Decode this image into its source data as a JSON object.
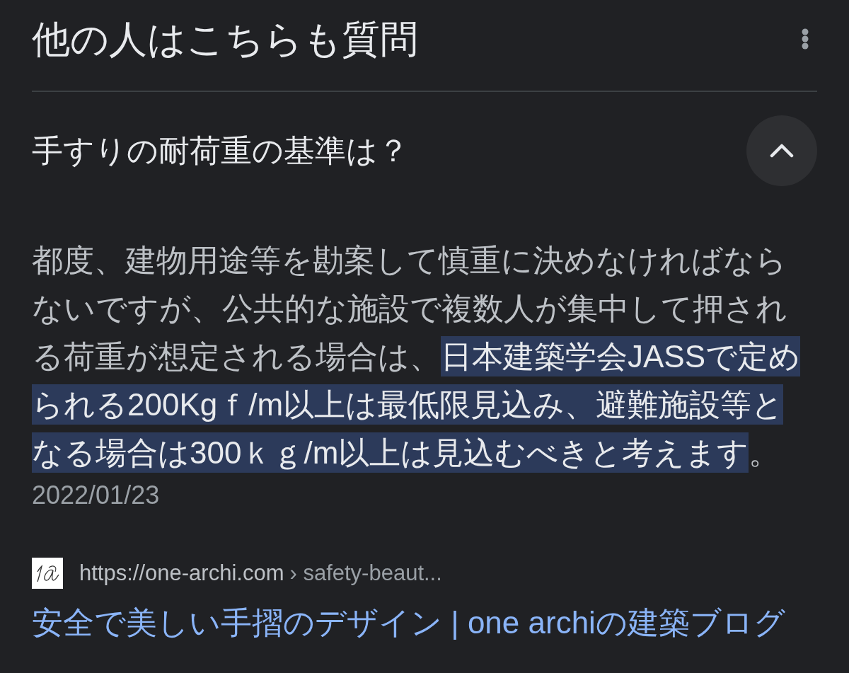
{
  "header": {
    "title": "他の人はこちらも質問"
  },
  "questions": [
    {
      "question": "手すりの耐荷重の基準は？",
      "expanded": true,
      "answer": {
        "segments": [
          {
            "text": "都度、建物用途等を勘案して慎重に決めなければならないですが、公共的な施設で複数人が集中して押される荷重が想定される場合は、",
            "highlighted": false
          },
          {
            "text": "日本建築学会JASSで定められる200Kgｆ/m以上は最低限見込み、避難施設等となる場合は300ｋｇ/m以上は見込むべきと考えます",
            "highlighted": true
          },
          {
            "text": "。",
            "highlighted": false
          }
        ]
      },
      "date": "2022/01/23",
      "source": {
        "url": "https://one-archi.com",
        "path": "› safety-beaut...",
        "title": "安全で美しい手摺のデザイン | one archiの建築ブログ"
      }
    }
  ]
}
